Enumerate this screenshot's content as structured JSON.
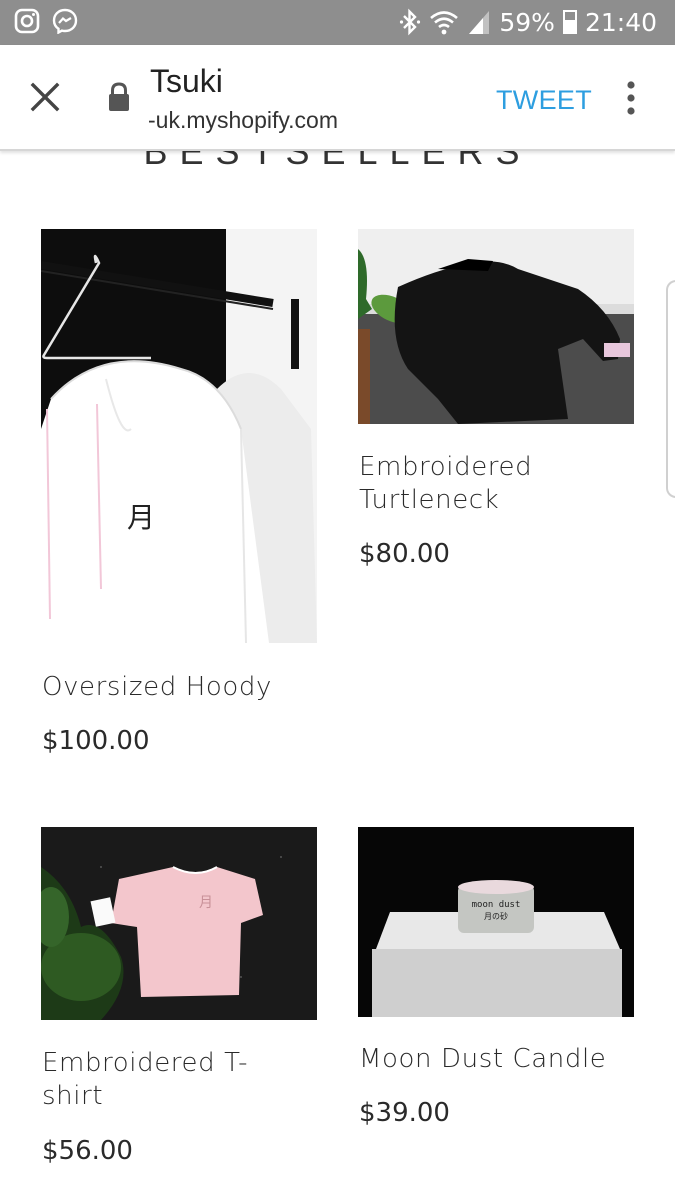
{
  "status_bar": {
    "left_icons": [
      "instagram-icon",
      "messenger-icon"
    ],
    "right_icons": [
      "bluetooth-icon",
      "wifi-icon",
      "signal-icon",
      "battery-icon"
    ],
    "battery_percent": "59%",
    "battery_level": 0.59,
    "time": "21:40"
  },
  "browser": {
    "title": "Tsuki",
    "url": "-uk.myshopify.com",
    "action_label": "TWEET",
    "action_color": "#2d9ee0",
    "icons": [
      "close-icon",
      "lock-icon",
      "more-vert-icon"
    ]
  },
  "section": {
    "title": "BESTSELLERS"
  },
  "products": [
    {
      "name": "Oversized Hoody",
      "price": "$100.00"
    },
    {
      "name": "Embroidered Turtleneck",
      "price": "$80.00"
    },
    {
      "name": "Embroidered T-shirt",
      "price": "$56.00"
    },
    {
      "name": "Moon Dust Candle",
      "price": "$39.00"
    }
  ],
  "image_text": {
    "moon_kanji": "月",
    "candle_label_1": "moon dust",
    "candle_label_2": "月の砂"
  }
}
